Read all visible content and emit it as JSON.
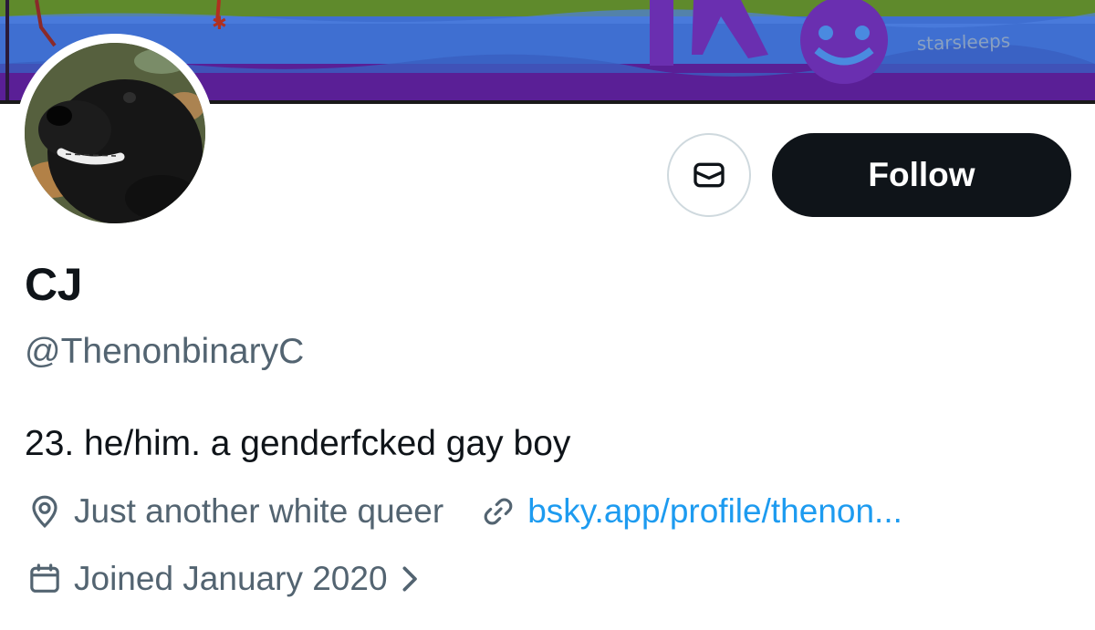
{
  "banner": {
    "watermark": "starsleeps"
  },
  "profile": {
    "display_name": "CJ",
    "handle": "@ThenonbinaryC",
    "bio": "23. he/him. a genderfcked gay boy",
    "location": "Just another white queer",
    "website": "bsky.app/profile/thenon...",
    "joined": "Joined January 2020"
  },
  "actions": {
    "follow_label": "Follow"
  },
  "icons": {
    "message": "envelope-icon",
    "location": "location-pin-icon",
    "link": "link-icon",
    "calendar": "calendar-icon",
    "expand": "chevron-right-icon"
  },
  "colors": {
    "text_primary": "#0f1419",
    "text_secondary": "#536471",
    "link": "#1d9bf0",
    "button_dark": "#0f1419"
  }
}
